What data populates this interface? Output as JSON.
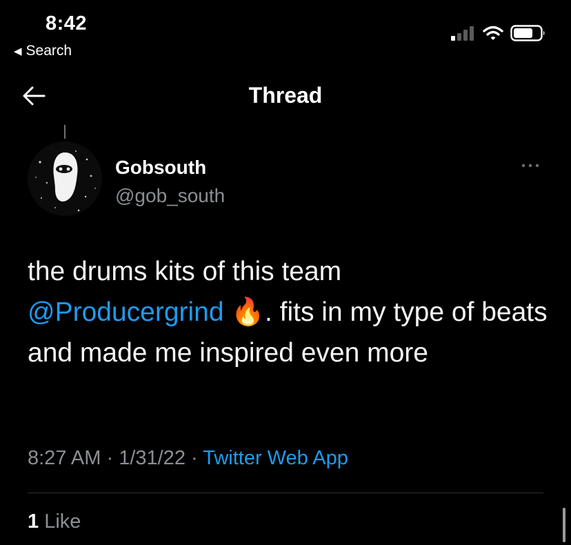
{
  "status": {
    "time": "8:42",
    "back_label": "Search"
  },
  "nav": {
    "title": "Thread"
  },
  "tweet": {
    "author_name": "Gobsouth",
    "author_handle": "@gob_south",
    "text_before": "the drums kits of this team",
    "mention": "@Producergrind",
    "emoji": "🔥",
    "text_after": ". fits in my type of beats and made me inspired even more",
    "time": "8:27 AM",
    "date": "1/31/22",
    "source": "Twitter Web App",
    "like_count": "1",
    "like_label": "Like"
  },
  "colors": {
    "accent": "#1d9bf0",
    "background": "#000000",
    "secondary_text": "#8b8f94"
  },
  "icons": {
    "back": "back-arrow-icon",
    "more": "more-options-icon",
    "signal": "signal-icon",
    "wifi": "wifi-icon",
    "battery": "battery-icon"
  }
}
